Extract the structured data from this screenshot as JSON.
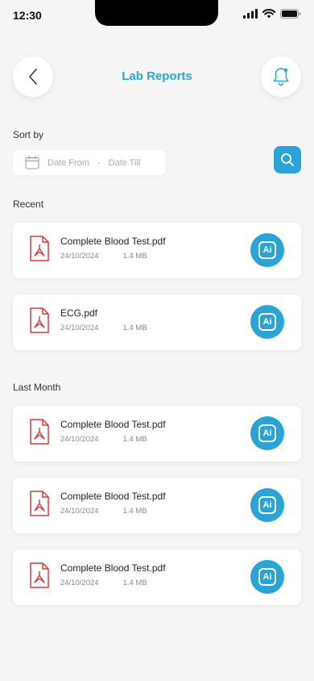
{
  "status_bar": {
    "time": "12:30"
  },
  "header": {
    "title": "Lab Reports"
  },
  "sort": {
    "label": "Sort by",
    "date_from": "Date From",
    "separator": "-",
    "date_till": "Date Till"
  },
  "sections": [
    {
      "label": "Recent",
      "files": [
        {
          "name": "Complete Blood Test.pdf",
          "date": "24/10/2024",
          "size": "1.4 MB",
          "ai_label": "Ai"
        },
        {
          "name": "ECG.pdf",
          "date": "24/10/2024",
          "size": "1.4 MB",
          "ai_label": "Ai"
        }
      ]
    },
    {
      "label": "Last Month",
      "files": [
        {
          "name": "Complete Blood Test.pdf",
          "date": "24/10/2024",
          "size": "1.4 MB",
          "ai_label": "Ai"
        },
        {
          "name": "Complete Blood Test.pdf",
          "date": "24/10/2024",
          "size": "1.4 MB",
          "ai_label": "Ai"
        },
        {
          "name": "Complete Blood Test.pdf",
          "date": "24/10/2024",
          "size": "1.4 MB",
          "ai_label": "Ai"
        }
      ]
    }
  ],
  "colors": {
    "accent": "#2aa3d6",
    "pdf_red": "#d63b3b",
    "background": "#f5f5f5"
  }
}
